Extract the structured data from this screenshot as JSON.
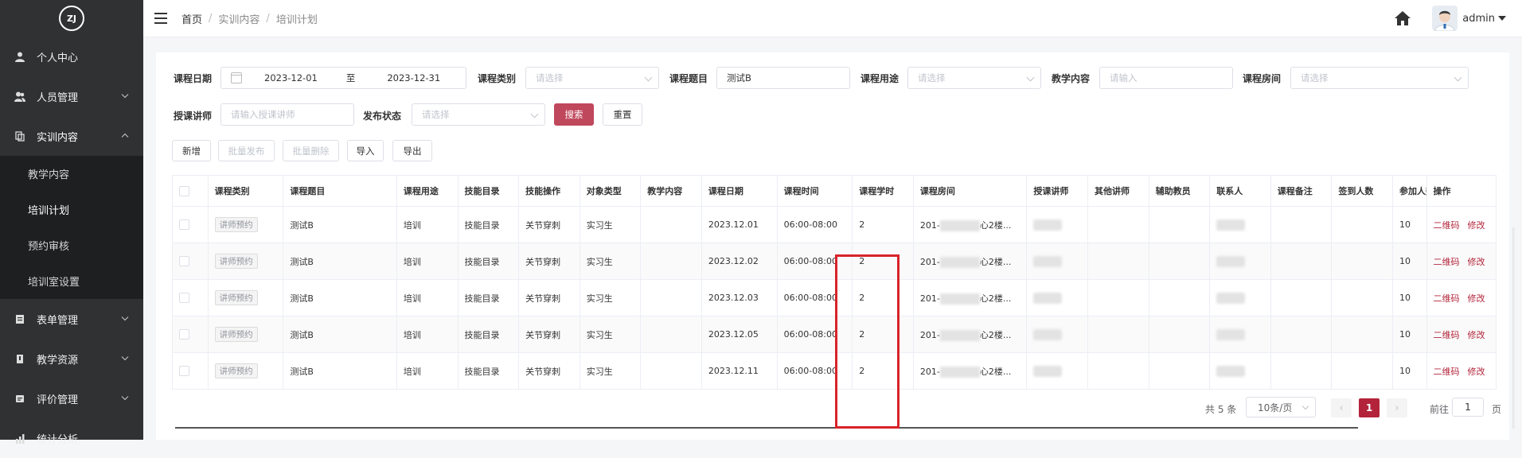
{
  "sidebar": {
    "logo_text": "ZJ",
    "items": [
      {
        "label": "个人中心",
        "icon": "user-icon",
        "chevron": ""
      },
      {
        "label": "人员管理",
        "icon": "users-icon",
        "chevron": "⌄"
      },
      {
        "label": "实训内容",
        "icon": "content-icon",
        "chevron": "⌃"
      },
      {
        "label": "表单管理",
        "icon": "form-icon",
        "chevron": "⌄"
      },
      {
        "label": "教学资源",
        "icon": "resource-icon",
        "chevron": "⌄"
      },
      {
        "label": "评价管理",
        "icon": "evaluate-icon",
        "chevron": "⌄"
      },
      {
        "label": "统计分析",
        "icon": "chart-icon",
        "chevron": ""
      }
    ],
    "sub_items": [
      "教学内容",
      "培训计划",
      "预约审核",
      "培训室设置"
    ],
    "active_sub": "培训计划"
  },
  "header": {
    "breadcrumb": [
      "首页",
      "实训内容",
      "培训计划"
    ],
    "sep": "/",
    "user": "admin"
  },
  "filters": {
    "course_date_label": "课程日期",
    "date_start": "2023-12-01",
    "date_to": "至",
    "date_end": "2023-12-31",
    "course_type_label": "课程类别",
    "course_type_placeholder": "请选择",
    "course_title_label": "课程题目",
    "course_title_value": "测试B",
    "course_use_label": "课程用途",
    "course_use_placeholder": "请选择",
    "teaching_content_label": "教学内容",
    "teaching_content_placeholder": "请输入",
    "course_room_label": "课程房间",
    "course_room_placeholder": "请选择",
    "teacher_label": "授课讲师",
    "teacher_placeholder": "请输入授课讲师",
    "publish_status_label": "发布状态",
    "publish_status_placeholder": "请选择",
    "search_btn": "搜索",
    "reset_btn": "重置"
  },
  "toolbar": {
    "add": "新增",
    "batch_publish": "批量发布",
    "batch_delete": "批量删除",
    "import": "导入",
    "export": "导出"
  },
  "table": {
    "headers": [
      "课程类别",
      "课程题目",
      "课程用途",
      "技能目录",
      "技能操作",
      "对象类型",
      "教学内容",
      "课程日期",
      "课程时间",
      "课程学时",
      "课程房间",
      "授课讲师",
      "其他讲师",
      "辅助教员",
      "联系人",
      "课程备注",
      "签到人数",
      "参加人数",
      "操作"
    ],
    "rows": [
      {
        "type": "讲师预约",
        "title": "测试B",
        "use": "培训",
        "skill_dir": "技能目录",
        "skill_op": "关节穿刺",
        "target": "实习生",
        "content": "",
        "date": "2023.12.01",
        "time": "06:00-08:00",
        "hours": "2",
        "room_a": "201-",
        "room_b": "心2楼...",
        "join": "10"
      },
      {
        "type": "讲师预约",
        "title": "测试B",
        "use": "培训",
        "skill_dir": "技能目录",
        "skill_op": "关节穿刺",
        "target": "实习生",
        "content": "",
        "date": "2023.12.02",
        "time": "06:00-08:00",
        "hours": "2",
        "room_a": "201-",
        "room_b": "心2楼...",
        "join": "10"
      },
      {
        "type": "讲师预约",
        "title": "测试B",
        "use": "培训",
        "skill_dir": "技能目录",
        "skill_op": "关节穿刺",
        "target": "实习生",
        "content": "",
        "date": "2023.12.03",
        "time": "06:00-08:00",
        "hours": "2",
        "room_a": "201-",
        "room_b": "心2楼...",
        "join": "10"
      },
      {
        "type": "讲师预约",
        "title": "测试B",
        "use": "培训",
        "skill_dir": "技能目录",
        "skill_op": "关节穿刺",
        "target": "实习生",
        "content": "",
        "date": "2023.12.05",
        "time": "06:00-08:00",
        "hours": "2",
        "room_a": "201-",
        "room_b": "心2楼...",
        "join": "10"
      },
      {
        "type": "讲师预约",
        "title": "测试B",
        "use": "培训",
        "skill_dir": "技能目录",
        "skill_op": "关节穿刺",
        "target": "实习生",
        "content": "",
        "date": "2023.12.11",
        "time": "06:00-08:00",
        "hours": "2",
        "room_a": "201-",
        "room_b": "心2楼...",
        "join": "10"
      }
    ],
    "op_qrcode": "二维码",
    "op_edit": "修改"
  },
  "pagination": {
    "total": "共 5 条",
    "page_size": "10条/页",
    "prev": "‹",
    "current": "1",
    "next": "›",
    "goto_label": "前往",
    "goto_value": "1",
    "page_unit": "页"
  },
  "colors": {
    "sidebar_bg": "#2f3132",
    "accent": "#b3243a",
    "highlight": "#d8232a"
  }
}
